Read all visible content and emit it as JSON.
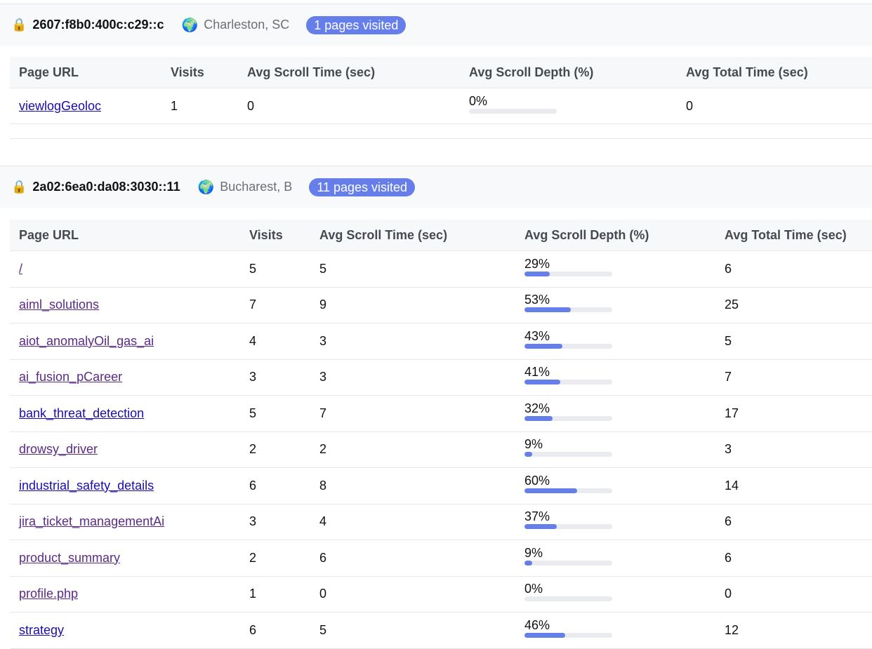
{
  "columns": {
    "url": "Page URL",
    "visits": "Visits",
    "scroll_time": "Avg Scroll Time (sec)",
    "scroll_depth": "Avg Scroll Depth (%)",
    "total_time": "Avg Total Time (sec)"
  },
  "colors": {
    "accent": "#667eea",
    "link": "#1a0dab",
    "visited_link": "#5b2a86"
  },
  "visitors": [
    {
      "lock_icon": "🔒",
      "ip": "2607:f8b0:400c:c29::c",
      "globe_icon": "🌍",
      "location": "Charleston, SC",
      "badge": "1 pages visited",
      "rows": [
        {
          "url": "viewlogGeoloc",
          "visited": false,
          "visits": "1",
          "scroll_time": "0",
          "depth_label": "0%",
          "depth": 0,
          "total_time": "0"
        }
      ]
    },
    {
      "lock_icon": "🔒",
      "ip": "2a02:6ea0:da08:3030::11",
      "globe_icon": "🌍",
      "location": "Bucharest, B",
      "badge": "11 pages visited",
      "rows": [
        {
          "url": "/",
          "visited": true,
          "visits": "5",
          "scroll_time": "5",
          "depth_label": "29%",
          "depth": 29,
          "total_time": "6"
        },
        {
          "url": "aiml_solutions",
          "visited": true,
          "visits": "7",
          "scroll_time": "9",
          "depth_label": "53%",
          "depth": 53,
          "total_time": "25"
        },
        {
          "url": "aiot_anomalyOil_gas_ai",
          "visited": true,
          "visits": "4",
          "scroll_time": "3",
          "depth_label": "43%",
          "depth": 43,
          "total_time": "5"
        },
        {
          "url": "ai_fusion_pCareer",
          "visited": true,
          "visits": "3",
          "scroll_time": "3",
          "depth_label": "41%",
          "depth": 41,
          "total_time": "7"
        },
        {
          "url": "bank_threat_detection",
          "visited": false,
          "visits": "5",
          "scroll_time": "7",
          "depth_label": "32%",
          "depth": 32,
          "total_time": "17"
        },
        {
          "url": "drowsy_driver",
          "visited": true,
          "visits": "2",
          "scroll_time": "2",
          "depth_label": "9%",
          "depth": 9,
          "total_time": "3"
        },
        {
          "url": "industrial_safety_details",
          "visited": false,
          "visits": "6",
          "scroll_time": "8",
          "depth_label": "60%",
          "depth": 60,
          "total_time": "14"
        },
        {
          "url": "jira_ticket_managementAi",
          "visited": true,
          "visits": "3",
          "scroll_time": "4",
          "depth_label": "37%",
          "depth": 37,
          "total_time": "6"
        },
        {
          "url": "product_summary",
          "visited": true,
          "visits": "2",
          "scroll_time": "6",
          "depth_label": "9%",
          "depth": 9,
          "total_time": "6"
        },
        {
          "url": "profile.php",
          "visited": true,
          "visits": "1",
          "scroll_time": "0",
          "depth_label": "0%",
          "depth": 0,
          "total_time": "0"
        },
        {
          "url": "strategy",
          "visited": false,
          "visits": "6",
          "scroll_time": "5",
          "depth_label": "46%",
          "depth": 46,
          "total_time": "12"
        }
      ]
    }
  ]
}
